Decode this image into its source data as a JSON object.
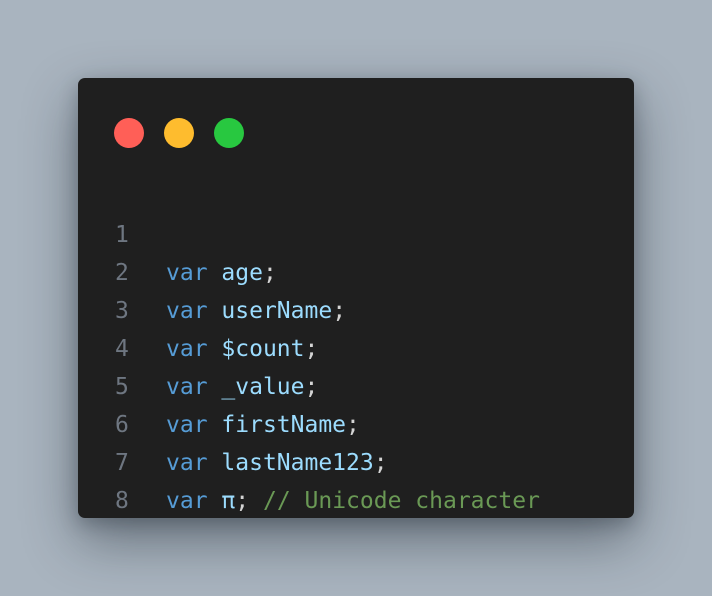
{
  "window": {
    "traffic_lights": [
      {
        "name": "close",
        "color": "#ff5f57"
      },
      {
        "name": "minimize",
        "color": "#febc2e"
      },
      {
        "name": "zoom",
        "color": "#28c840"
      }
    ]
  },
  "colors": {
    "background": "#a9b4bf",
    "editor_bg": "#1f1f1f",
    "line_number": "#6e7681",
    "keyword": "#569cd6",
    "identifier": "#9cdcfe",
    "punctuation": "#d4d4d4",
    "comment": "#6a9955"
  },
  "code": {
    "lines": [
      {
        "number": "1",
        "keyword": "var",
        "space": " ",
        "identifier": "age",
        "punct": ";",
        "comment": ""
      },
      {
        "number": "2",
        "keyword": "var",
        "space": " ",
        "identifier": "userName",
        "punct": ";",
        "comment": ""
      },
      {
        "number": "3",
        "keyword": "var",
        "space": " ",
        "identifier": "$count",
        "punct": ";",
        "comment": ""
      },
      {
        "number": "4",
        "keyword": "var",
        "space": " ",
        "identifier": "_value",
        "punct": ";",
        "comment": ""
      },
      {
        "number": "5",
        "keyword": "var",
        "space": " ",
        "identifier": "firstName",
        "punct": ";",
        "comment": ""
      },
      {
        "number": "6",
        "keyword": "var",
        "space": " ",
        "identifier": "lastName123",
        "punct": ";",
        "comment": ""
      },
      {
        "number": "7",
        "keyword": "var",
        "space": " ",
        "identifier": "π",
        "punct": ";",
        "comment": " // Unicode character"
      },
      {
        "number": "8",
        "keyword": "",
        "space": "",
        "identifier": "",
        "punct": "",
        "comment": ""
      }
    ]
  }
}
